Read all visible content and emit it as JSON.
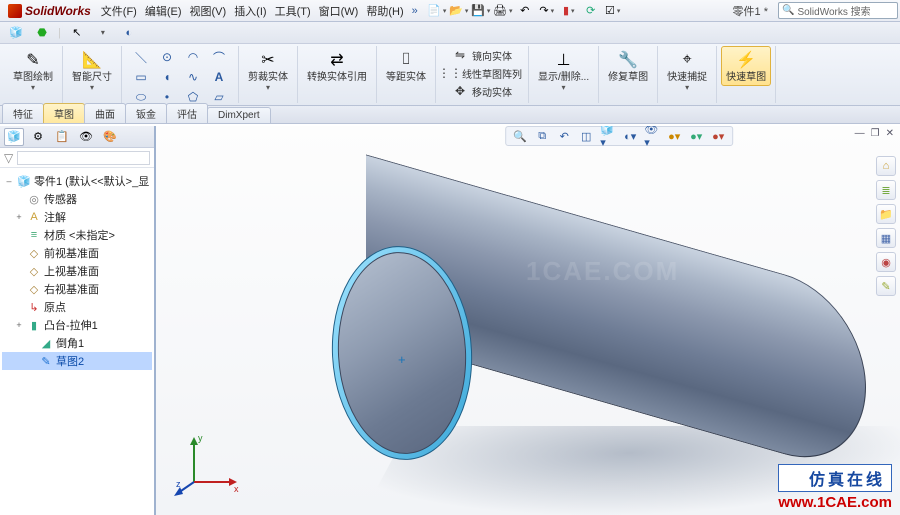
{
  "app": {
    "name": "SolidWorks",
    "search_placeholder": "SolidWorks 搜索",
    "document": "零件1 *"
  },
  "menu": {
    "file": "文件(F)",
    "edit": "编辑(E)",
    "view": "视图(V)",
    "insert": "插入(I)",
    "tools": "工具(T)",
    "window": "窗口(W)",
    "help": "帮助(H)"
  },
  "ribbon": {
    "sketch": "草图绘制",
    "smart_dim": "智能尺寸",
    "trim": "剪裁实体",
    "convert": "转换实体引用",
    "offset": "等距实体",
    "mirror": "镜向实体",
    "linear_pattern": "线性草图阵列",
    "move": "移动实体",
    "display_delete": "显示/删除...",
    "repair": "修复草图",
    "quick_snap": "快速捕捉",
    "rapid_sketch": "快速草图"
  },
  "fm_tabs": {
    "features": "特征",
    "sketch": "草图",
    "surfaces": "曲面",
    "sheetmetal": "钣金",
    "evaluate": "评估",
    "dimxpert": "DimXpert"
  },
  "tree": {
    "root": "零件1 (默认<<默认>_显",
    "sensors": "传感器",
    "annotations": "注解",
    "material": "材质 <未指定>",
    "front": "前视基准面",
    "top": "上视基准面",
    "right": "右视基准面",
    "origin": "原点",
    "boss": "凸台-拉伸1",
    "fillet": "倒角1",
    "sketch2": "草图2"
  },
  "watermark": "1CAE.COM",
  "brand": {
    "cn": "仿真在线",
    "url": "www.1CAE.com"
  },
  "triad": {
    "x": "x",
    "y": "y",
    "z": "z"
  }
}
